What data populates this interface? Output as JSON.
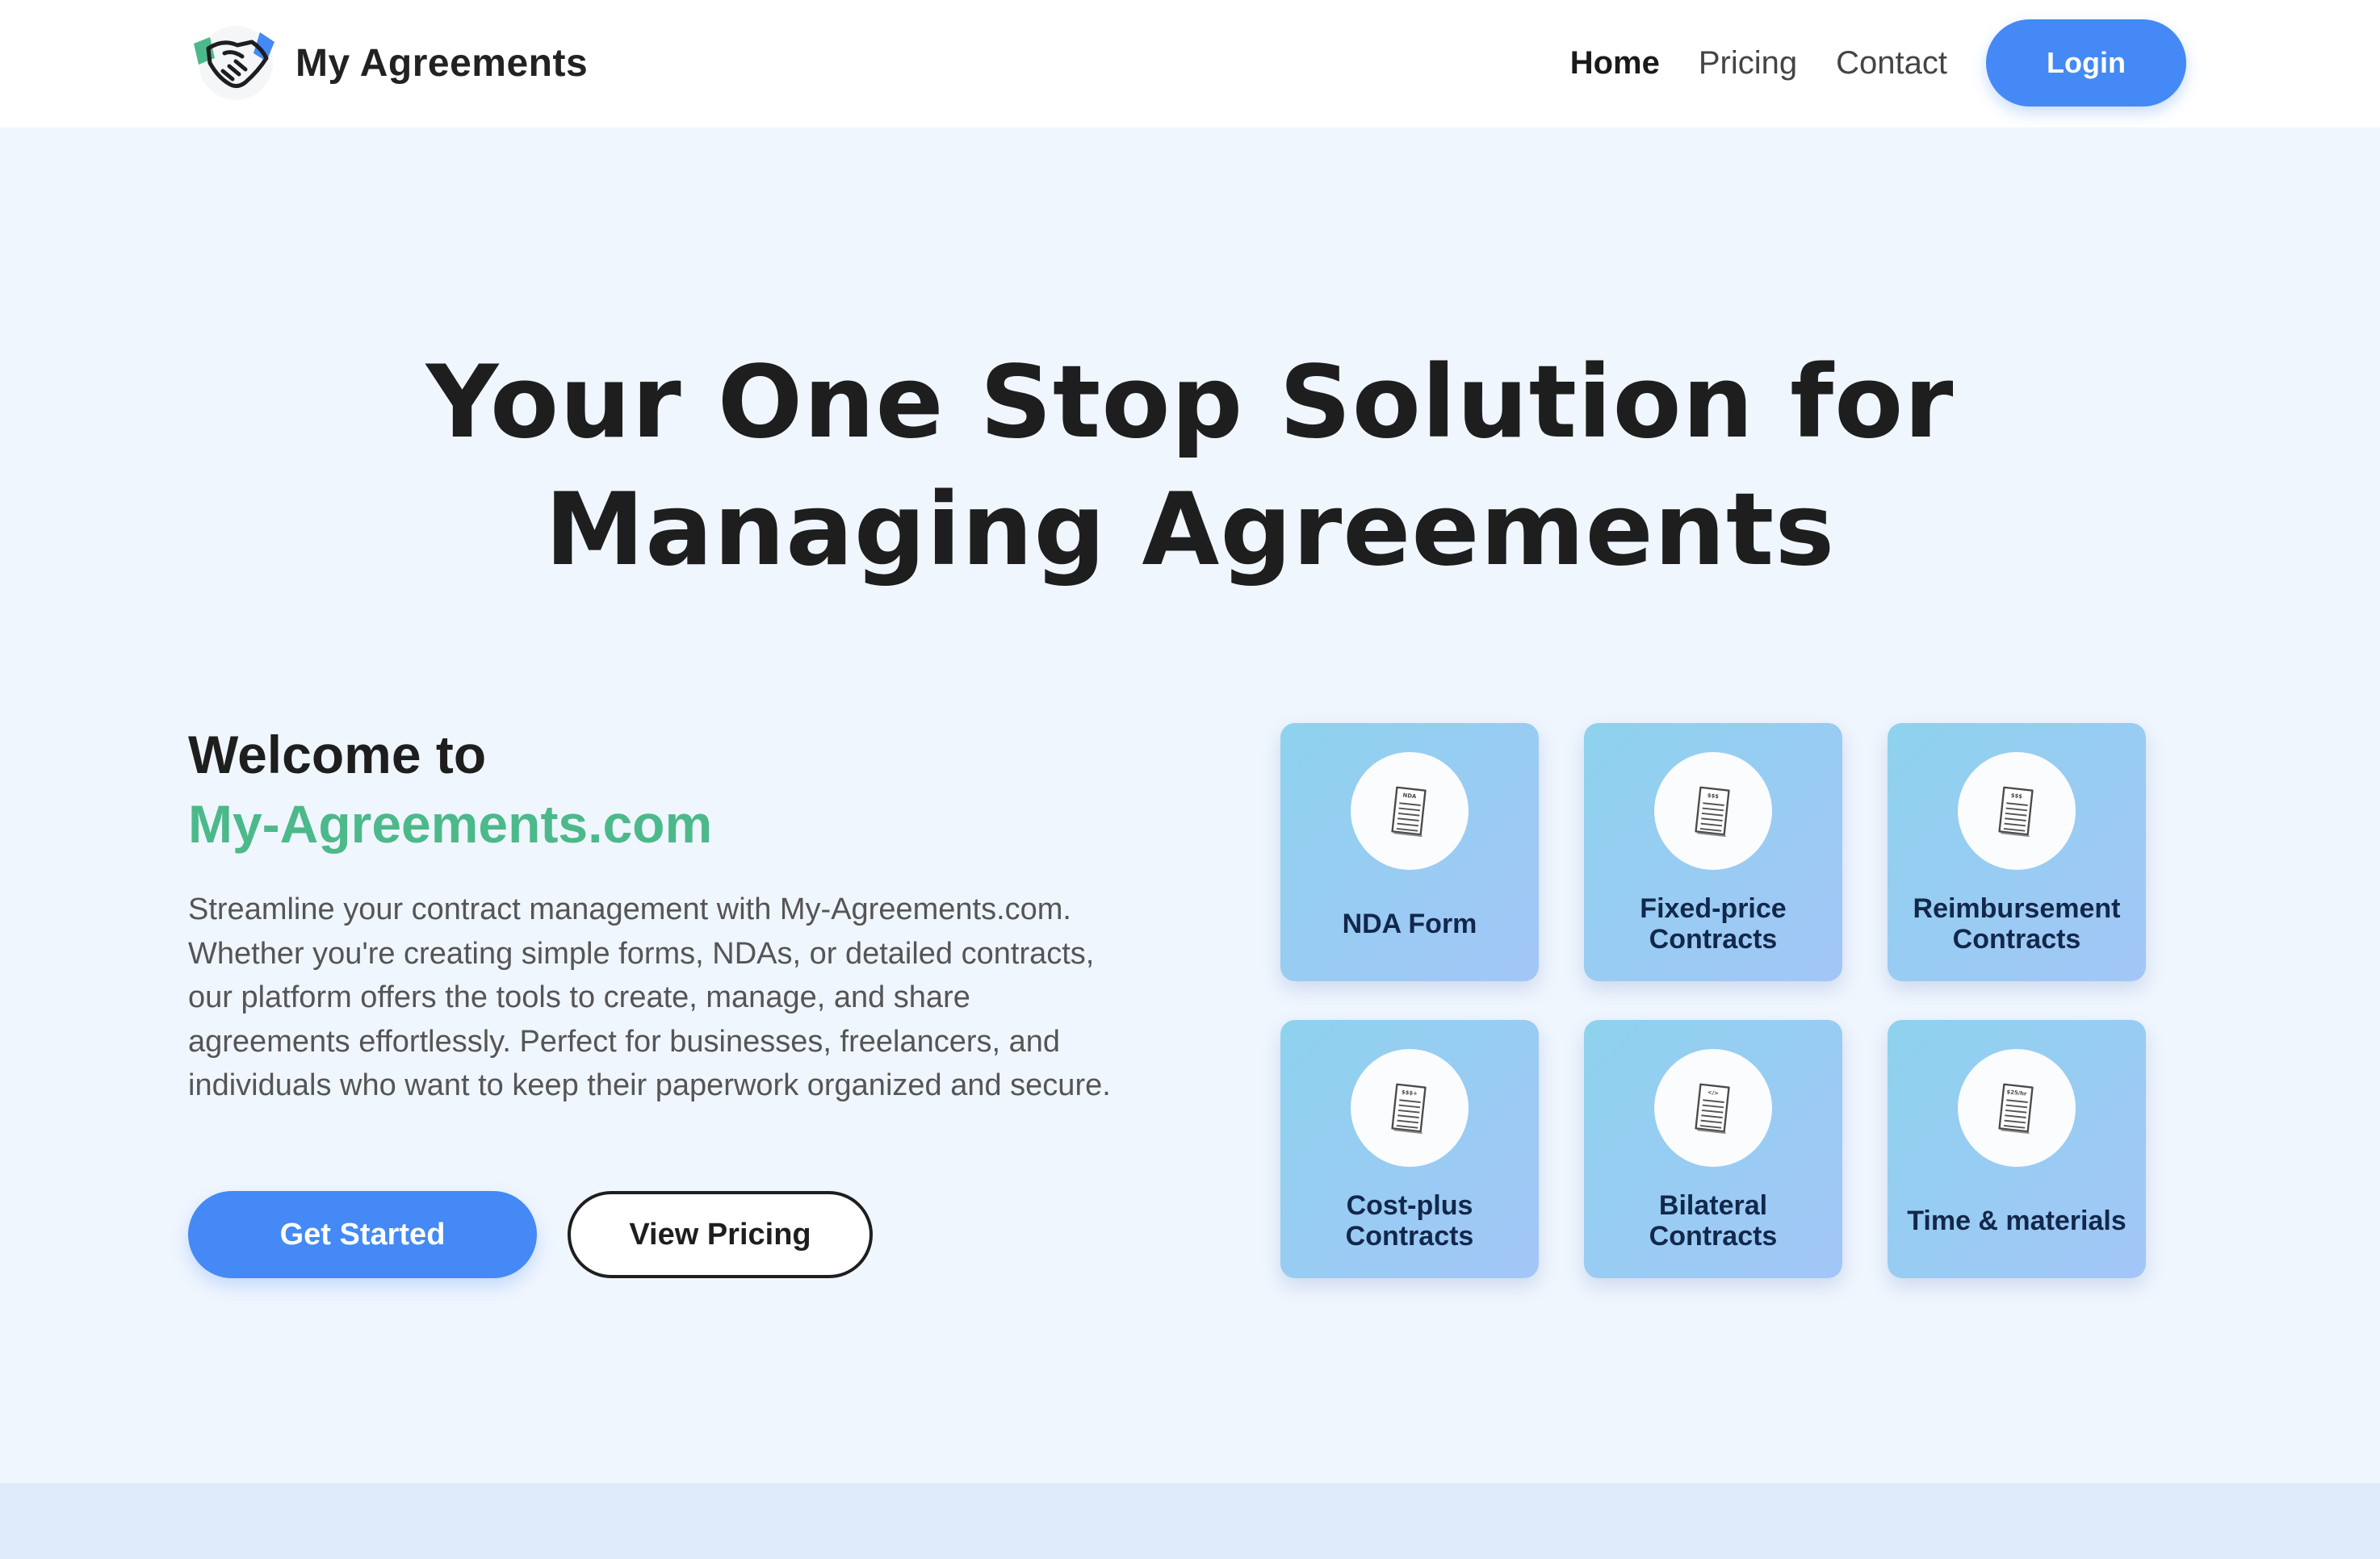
{
  "header": {
    "brand": "My Agreements",
    "nav": [
      {
        "label": "Home",
        "active": true
      },
      {
        "label": "Pricing",
        "active": false
      },
      {
        "label": "Contact",
        "active": false
      }
    ],
    "login_label": "Login"
  },
  "hero": {
    "title_line1": "Your One Stop Solution for",
    "title_line2": "Managing Agreements"
  },
  "welcome": {
    "line1": "Welcome to",
    "line2": "My-Agreements.com",
    "description": "Streamline your contract management with My-Agreements.com. Whether you're creating simple forms, NDAs, or detailed contracts, our platform offers the tools to create, manage, and share agreements effortlessly. Perfect for businesses, freelancers, and individuals who want to keep their paperwork organized and secure.",
    "primary_cta": "Get Started",
    "secondary_cta": "View Pricing"
  },
  "cards": [
    {
      "label": "NDA Form",
      "icon_tag": "NDA",
      "icon": "document-icon"
    },
    {
      "label": "Fixed-price Contracts",
      "icon_tag": "$$$",
      "icon": "document-icon"
    },
    {
      "label": "Reimbursement Contracts",
      "icon_tag": "$$$",
      "icon": "document-icon"
    },
    {
      "label": "Cost-plus Contracts",
      "icon_tag": "$$$+",
      "icon": "document-icon"
    },
    {
      "label": "Bilateral Contracts",
      "icon_tag": "</>",
      "icon": "document-icon"
    },
    {
      "label": "Time & materials",
      "icon_tag": "$25/hr",
      "icon": "document-icon"
    }
  ],
  "colors": {
    "accent": "#4489f5",
    "brand_green": "#4cb98a",
    "page_bg": "#f0f6fe",
    "card_navy": "#12284a"
  }
}
